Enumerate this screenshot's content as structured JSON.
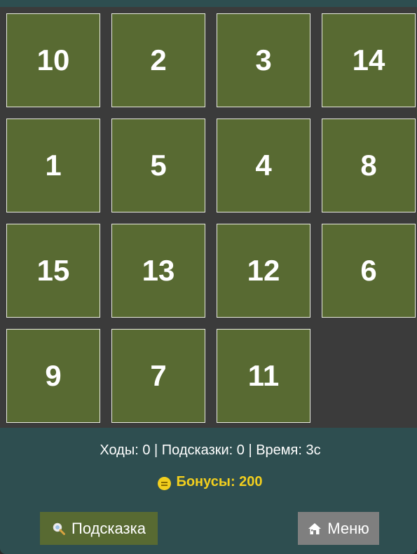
{
  "board": {
    "rows": [
      [
        "10",
        "2",
        "3",
        "14"
      ],
      [
        "1",
        "5",
        "4",
        "8"
      ],
      [
        "15",
        "13",
        "12",
        "6"
      ],
      [
        "9",
        "7",
        "11",
        ""
      ]
    ]
  },
  "stats": {
    "text": "Ходы: 0 | Подсказки: 0 | Время: 3с"
  },
  "bonus": {
    "text": "Бонусы: 200",
    "icon": "coin-icon",
    "color": "#f2cf1e"
  },
  "buttons": {
    "hint_label": "Подсказка",
    "hint_icon": "magnifier-icon",
    "menu_label": "Меню",
    "menu_icon": "home-icon"
  },
  "colors": {
    "tile": "#586a32",
    "board_bg": "#3b3b3b",
    "panel_bg": "#2e4e50",
    "menu_button": "#7f7f7f"
  }
}
